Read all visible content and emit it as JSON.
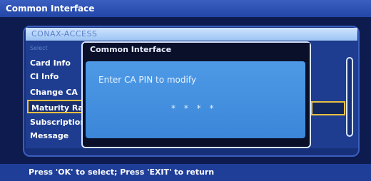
{
  "window": {
    "title": "Common Interface"
  },
  "conax": {
    "header": "CONAX-ACCESS",
    "menu": [
      {
        "label": "Select",
        "state": "dim"
      },
      {
        "label": "Card Info",
        "state": "normal"
      },
      {
        "label": "CI Info",
        "state": "normal"
      },
      {
        "label": "Change CA",
        "state": "normal"
      },
      {
        "label": "Maturity Rat",
        "state": "selected"
      },
      {
        "label": "Subscription",
        "state": "normal"
      },
      {
        "label": "Message",
        "state": "normal"
      }
    ]
  },
  "dialog": {
    "title": "Common Interface",
    "prompt": "Enter CA PIN to modify",
    "pin_mask": "* * * *"
  },
  "footer": {
    "hint": "Press 'OK' to select; Press 'EXIT' to return"
  },
  "colors": {
    "accent": "#e8c040",
    "dialog_body": "#4e9ae6",
    "titlebar": "#2347a8"
  }
}
